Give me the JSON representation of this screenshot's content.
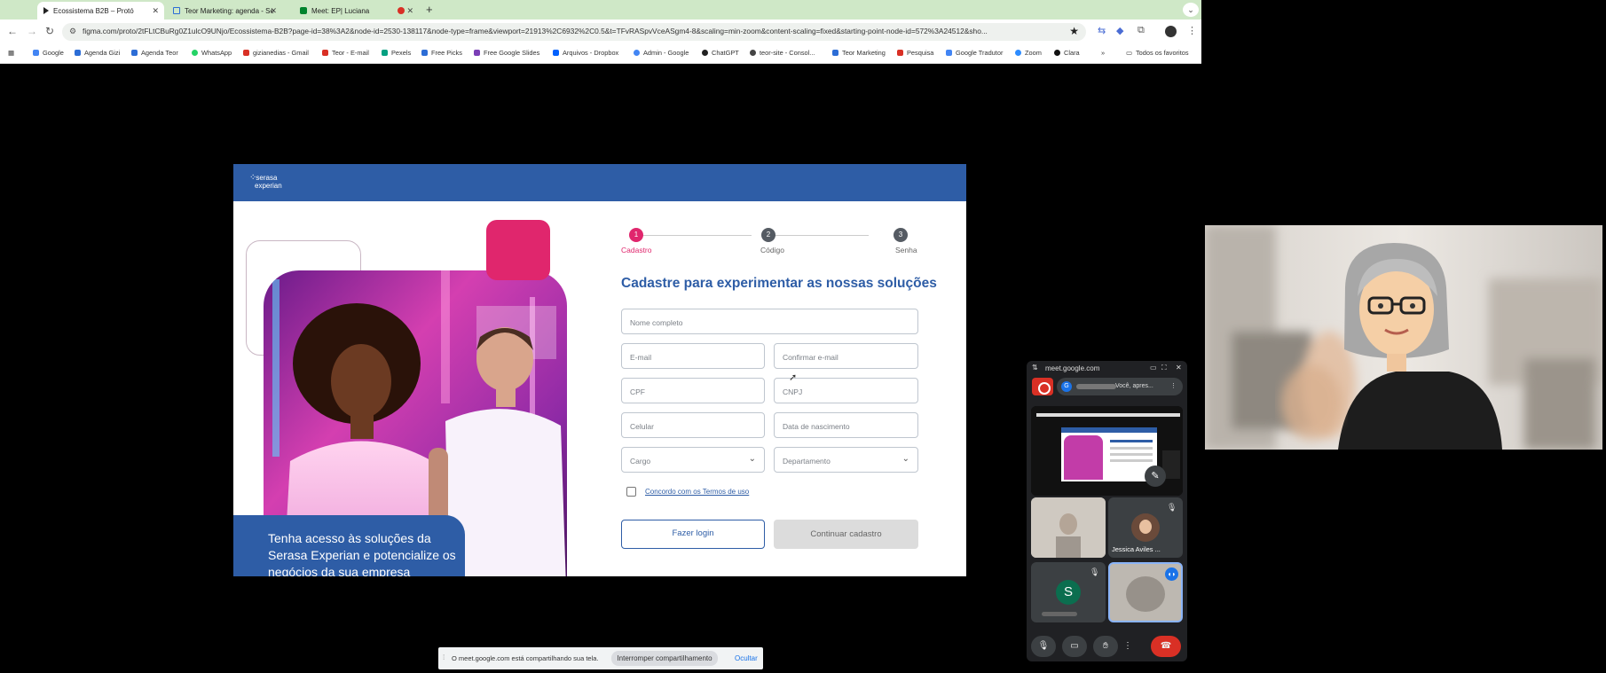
{
  "browser": {
    "tabs": [
      {
        "title": "Ecossistema B2B – Protó"
      },
      {
        "title": "Teor Marketing: agenda - Se"
      },
      {
        "title": "Meet: EP| Luciana"
      }
    ],
    "url": "figma.com/proto/2tFLtCBuRg0Z1ulcO9UNjo/Ecossistema-B2B?page-id=38%3A2&node-id=2530-138117&node-type=frame&viewport=21913%2C6932%2C0.5&t=TFvRASpvVceASgm4-8&scaling=min-zoom&content-scaling=fixed&starting-point-node-id=572%3A24512&sho...",
    "bookmarks": [
      "Google",
      "Agenda Gizi",
      "Agenda Teor",
      "WhatsApp",
      "gizianedias - Gmail",
      "Teor - E-mail",
      "Pexels",
      "Free Picks",
      "Free Google Slides",
      "Arquivos - Dropbox",
      "Admin - Google",
      "ChatGPT",
      "teor-site - Consol...",
      "Teor Marketing",
      "Pesquisa",
      "Google Tradutor",
      "Zoom",
      "Clara"
    ],
    "all_bookmarks": "Todos os favoritos"
  },
  "prototype": {
    "logo_line1": "serasa",
    "logo_line2": "experian",
    "banner_text": "Tenha acesso às soluções da Serasa Experian e potencialize os negócios da sua empresa",
    "steps": [
      {
        "num": "1",
        "label": "Cadastro",
        "color": "#e0266d"
      },
      {
        "num": "2",
        "label": "Código",
        "color": "#555b63"
      },
      {
        "num": "3",
        "label": "Senha",
        "color": "#555b63"
      }
    ],
    "form_title": "Cadastre para experimentar as nossas soluções",
    "fields": {
      "full_name": "Nome completo",
      "email": "E-mail",
      "confirm_email": "Confirmar e-mail",
      "cpf": "CPF",
      "cnpj": "CNPJ",
      "phone": "Celular",
      "birth": "Data de nascimento",
      "role": "Cargo",
      "department": "Departamento"
    },
    "terms": "Concordo com os Termos de uso",
    "login_button": "Fazer login",
    "continue_button": "Continuar cadastro",
    "brand_blue": "#2e5da6",
    "brand_pink": "#e0266d"
  },
  "meet": {
    "domain": "meet.google.com",
    "presenting": "Você, apres...",
    "tiles": [
      {
        "name": ""
      },
      {
        "name": "Jessica Aviles ..."
      },
      {
        "initial": "S",
        "name": ""
      },
      {
        "name": ""
      }
    ]
  },
  "share_bar": {
    "text": "O meet.google.com está compartilhando sua tela.",
    "stop": "Interromper compartilhamento",
    "hide": "Ocultar"
  }
}
